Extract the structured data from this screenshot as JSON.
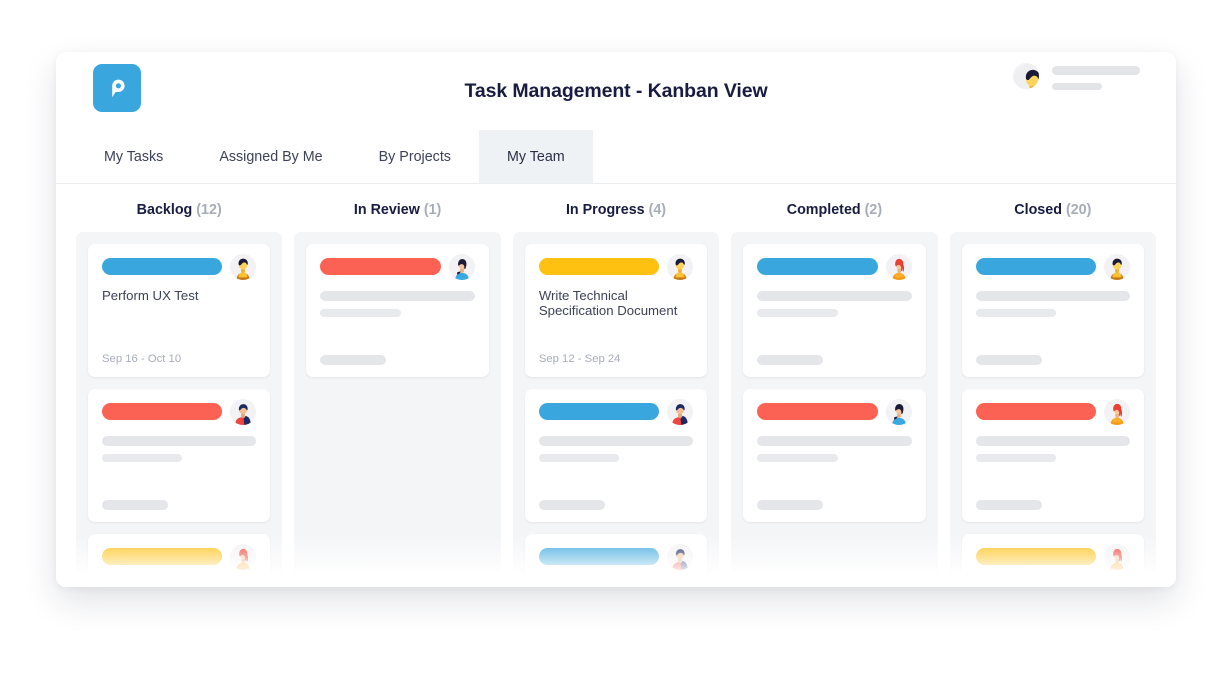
{
  "header": {
    "logo_icon": "pigeon-p-logo-icon",
    "title": "Task Management - Kanban View",
    "user": {
      "avatar_icon": "avatar-curly-dark-hair"
    }
  },
  "tabs": [
    {
      "label": "My Tasks",
      "active": false
    },
    {
      "label": "Assigned By Me",
      "active": false
    },
    {
      "label": "By Projects",
      "active": false
    },
    {
      "label": "My Team",
      "active": true
    }
  ],
  "colors": {
    "blue": "#39A7DE",
    "red": "#FB6254",
    "yellow": "#FEC011",
    "title_text": "#171C40",
    "count_text": "#A7ACB9",
    "column_bg": "#F4F5F7",
    "active_tab_bg": "#EFF2F5"
  },
  "board": {
    "columns": [
      {
        "name": "Backlog",
        "count": "(12)",
        "cards": [
          {
            "tag_color": "blue",
            "title": "Perform UX Test",
            "date": "Sep 16 - Oct 10",
            "avatar_icon": "avatar-curly-dark-hair",
            "placeholder": false
          },
          {
            "tag_color": "red",
            "title": "",
            "date": "",
            "avatar_icon": "avatar-navy-hair-red-top",
            "placeholder": true
          },
          {
            "tag_color": "yellow",
            "title": "",
            "date": "",
            "avatar_icon": "avatar-red-hair-orange-top",
            "placeholder": true
          }
        ]
      },
      {
        "name": "In Review",
        "count": "(1)",
        "cards": [
          {
            "tag_color": "red",
            "title": "",
            "date": "",
            "avatar_icon": "avatar-dark-hair-blue-top",
            "placeholder": true
          }
        ]
      },
      {
        "name": "In Progress",
        "count": "(4)",
        "cards": [
          {
            "tag_color": "yellow",
            "title": "Write Technical Specification Document",
            "date": "Sep 12 - Sep 24",
            "avatar_icon": "avatar-curly-dark-hair",
            "placeholder": false
          },
          {
            "tag_color": "blue",
            "title": "",
            "date": "",
            "avatar_icon": "avatar-navy-hair-red-top",
            "placeholder": true
          },
          {
            "tag_color": "blue",
            "title": "",
            "date": "",
            "avatar_icon": "avatar-navy-hair-red-top",
            "placeholder": true
          }
        ]
      },
      {
        "name": "Completed",
        "count": "(2)",
        "cards": [
          {
            "tag_color": "blue",
            "title": "",
            "date": "",
            "avatar_icon": "avatar-red-hair-orange-top",
            "placeholder": true
          },
          {
            "tag_color": "red",
            "title": "",
            "date": "",
            "avatar_icon": "avatar-dark-hair-blue-top",
            "placeholder": true
          }
        ]
      },
      {
        "name": "Closed",
        "count": "(20)",
        "cards": [
          {
            "tag_color": "blue",
            "title": "",
            "date": "",
            "avatar_icon": "avatar-curly-dark-hair",
            "placeholder": true
          },
          {
            "tag_color": "red",
            "title": "",
            "date": "",
            "avatar_icon": "avatar-red-hair-orange-top",
            "placeholder": true
          },
          {
            "tag_color": "yellow",
            "title": "",
            "date": "",
            "avatar_icon": "avatar-red-hair-orange-top",
            "placeholder": true
          }
        ]
      }
    ]
  }
}
